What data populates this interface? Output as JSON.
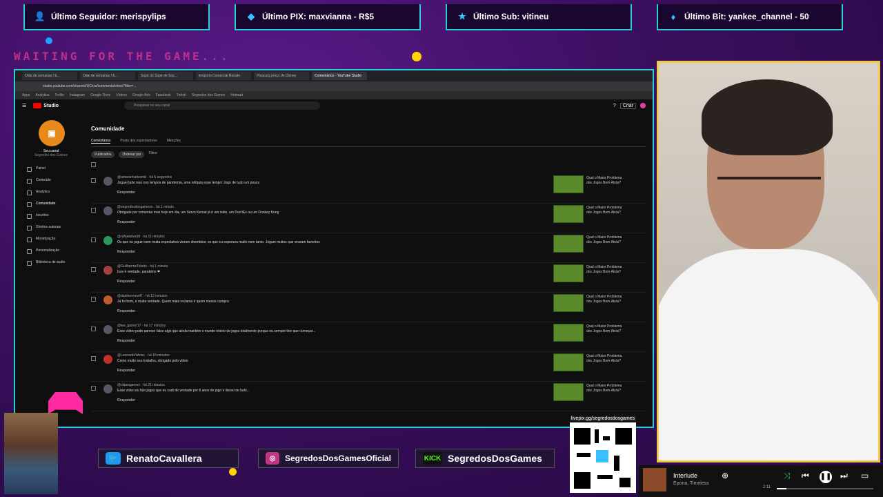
{
  "alerts": [
    {
      "icon": "user-icon",
      "text": "Último Seguidor: merispylips"
    },
    {
      "icon": "pix-icon",
      "text": "Último PIX: maxvianna - R$5"
    },
    {
      "icon": "star-icon",
      "text": "Último Sub: vitineu"
    },
    {
      "icon": "gem-icon",
      "text": "Último Bit: yankee_channel - 50"
    }
  ],
  "overlay": {
    "waiting": "WAITING FOR THE GAME..."
  },
  "browser": {
    "tabs": [
      "Odai de semanas / E...",
      "Odai de semanas / E...",
      "Sopé do Sopé de Sop...",
      "Emporio Comercial Renato",
      "Pinacurg preço do Disney",
      "Comentários - YouTube Studio"
    ],
    "url": "studio.youtube.com/channel/UCxxx/comments/inbox?filter=...",
    "bookmarks": [
      "Apps",
      "Analytics",
      "Trellio",
      "Instagram",
      "Google Drive",
      "Vídeos",
      "Google Ads",
      "Facebook",
      "Twitch",
      "Segredos dos Games",
      "Hotmart"
    ]
  },
  "studio": {
    "logo": "Studio",
    "search_placeholder": "Pesquisar no seu canal",
    "create_label": "Criar",
    "channel_name": "Seu canal",
    "channel_sub": "Segredos dos Games",
    "sidebar": [
      "Painel",
      "Conteúdo",
      "Analytics",
      "Comunidade",
      "Inscritos",
      "Direitos autorais",
      "Monetização",
      "Personalização",
      "Biblioteca de áudio"
    ],
    "page_title": "Comunidade",
    "subtabs": [
      "Comentários",
      "Posts dos espectadores",
      "Menções"
    ],
    "filters": {
      "chip": "Publicados",
      "sort": "Ordenar por",
      "filter": "Filtrar"
    },
    "comments": [
      {
        "author": "@amarocharlesmk · há 5 segundos",
        "text": "Joguei tudo isso nos tempos de pandemia, uma relíquia esse tempo! Jogo de tudo um pouco",
        "reply": "Responder",
        "video": "Qual o Maior Problema dos Jogos Bem Atrás?"
      },
      {
        "author": "@segredosdosgamesn · há 1 minuto",
        "text": "Obrigado por comentar mas hoje em dia, um Servo Kernal já é um indie, um Don'tEx ou um Donkey Kong",
        "reply": "Responder",
        "video": "Qual o Maior Problema dos Jogos Bem Atrás?"
      },
      {
        "author": "@rafaelsilva98 · há 11 minutos",
        "text": "Os que eu joguei sem muita expectativa vieram divertidos; os que eu esperava muito nem tanto. Joguei muitos que viraram favoritos",
        "reply": "Responder",
        "video": "Qual o Maior Problema dos Jogos Bem Atrás?"
      },
      {
        "author": "@GuilhermeToledo · há 1 minuto",
        "text": "Isso é verdade, parabéns ❤",
        "reply": "Responder",
        "video": "Qual o Maior Problema dos Jogos Bem Atrás?"
      },
      {
        "author": "@danihermes47 · há 12 minutos",
        "text": "Já foi bom, é muita verdade. Quem mais reclama é quem menos compra",
        "reply": "Responder",
        "video": "Qual o Maior Problema dos Jogos Bem Atrás?"
      },
      {
        "author": "@lee_gamer17 · há 17 minutos",
        "text": "Esse vídeo pode parecer falso algo que ainda mantém o mundo inteiro de jogos totalmente porque eu sempre tive que começar...",
        "reply": "Responder",
        "video": "Qual o Maior Problema dos Jogos Bem Atrás?"
      },
      {
        "author": "@LeonardoWeiss · há 18 minutos",
        "text": "Como muito seu trabalho, obrigado pelo vídeo",
        "reply": "Responder",
        "video": "Qual o Maior Problema dos Jogos Bem Atrás?"
      },
      {
        "author": "@clipesgames · há 21 minutos",
        "text": "Esse vídeo eu falo jogos que eu curti de verdade por 8 anos de jogo e deixei de lado...",
        "reply": "Responder",
        "video": "Qual o Maior Problema dos Jogos Bem Atrás?"
      }
    ]
  },
  "socials": [
    {
      "icon": "twitter-icon",
      "label": "RenatoCavallera"
    },
    {
      "icon": "instagram-icon",
      "label": "SegredosDosGamesOficial"
    },
    {
      "icon": "kick-icon",
      "badge": "KICK",
      "label": "SegredosDosGames"
    }
  ],
  "qr": {
    "url": "livepix.gg/segredosdosgames"
  },
  "player": {
    "title": "Interlude",
    "artist": "Epona, Timeless",
    "time": "2:11",
    "progress": 0.1
  },
  "colors": {
    "accent": "#2ad1d8",
    "cam_border": "#f2c84a",
    "yt_red": "#ff0000",
    "waiting": "#c0308a"
  }
}
